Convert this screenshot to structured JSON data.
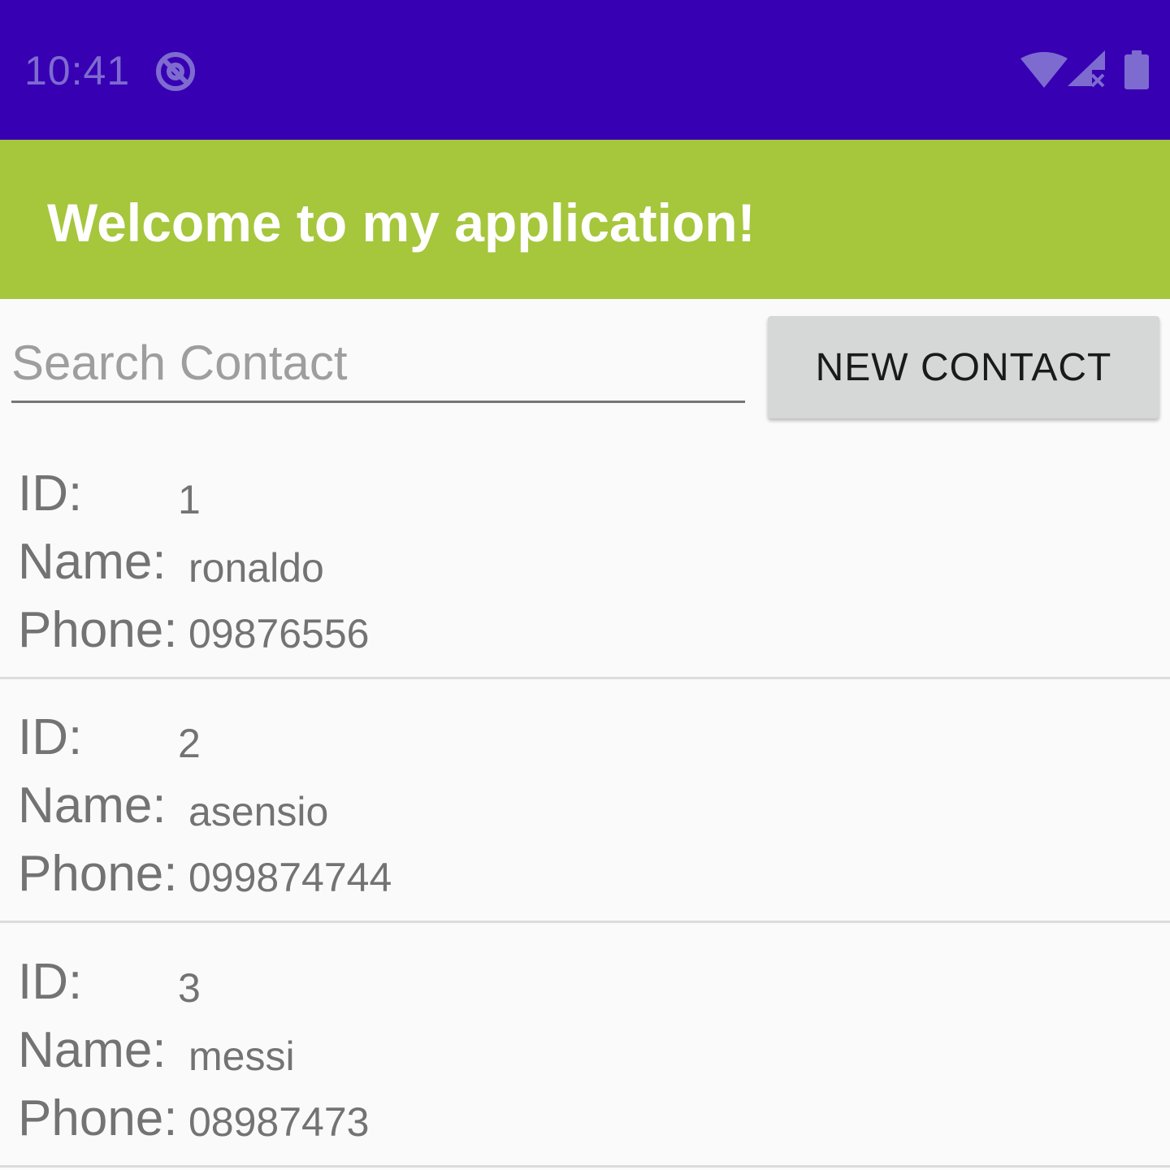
{
  "status_bar": {
    "time": "10:41",
    "icons": [
      "at-sign-icon",
      "wifi-icon",
      "cellular-signal-icon",
      "battery-icon"
    ],
    "color": "#3700b3"
  },
  "app_bar": {
    "title": "Welcome to my application!",
    "color": "#a6c63c"
  },
  "search": {
    "placeholder": "Search Contact",
    "value": ""
  },
  "new_contact_button": {
    "label": "NEW CONTACT"
  },
  "labels": {
    "id": "ID:",
    "name": "Name:",
    "phone": "Phone:"
  },
  "contacts": [
    {
      "id": "1",
      "name": "ronaldo",
      "phone": "09876556"
    },
    {
      "id": "2",
      "name": "asensio",
      "phone": "099874744"
    },
    {
      "id": "3",
      "name": "messi",
      "phone": "08987473"
    }
  ]
}
